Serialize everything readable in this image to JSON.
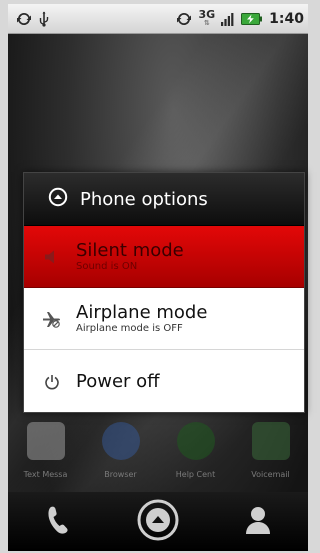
{
  "status_bar": {
    "network_type": "3G",
    "network_arrows": "⇅",
    "time": "1:40",
    "icons": [
      "sync-icon",
      "usb-icon",
      "sync-icon",
      "signal-icon",
      "battery-charging-icon"
    ]
  },
  "dialog": {
    "title": "Phone options",
    "options": [
      {
        "label": "Silent mode",
        "sublabel": "Sound is ON",
        "icon": "speaker-icon",
        "selected": true
      },
      {
        "label": "Airplane mode",
        "sublabel": "Airplane mode is OFF",
        "icon": "airplane-icon",
        "selected": false
      },
      {
        "label": "Power off",
        "icon": "power-icon",
        "selected": false
      }
    ]
  },
  "dock_apps": [
    {
      "label": "Text Messa",
      "icon": "messaging-icon",
      "color": "#cfcfcf"
    },
    {
      "label": "Browser",
      "icon": "globe-icon",
      "color": "#4a78c8"
    },
    {
      "label": "Help Cent",
      "icon": "help-icon",
      "color": "#2f7a2f"
    },
    {
      "label": "Voicemail",
      "icon": "voicemail-icon",
      "color": "#4f8a4f"
    }
  ],
  "bottom_bar": {
    "icons": [
      "phone-icon",
      "launcher-icon",
      "contacts-icon"
    ]
  },
  "colors": {
    "selected_option": "#d40000",
    "dialog_header": "#1a1a1a",
    "status_bar": "#e8e8e8"
  }
}
